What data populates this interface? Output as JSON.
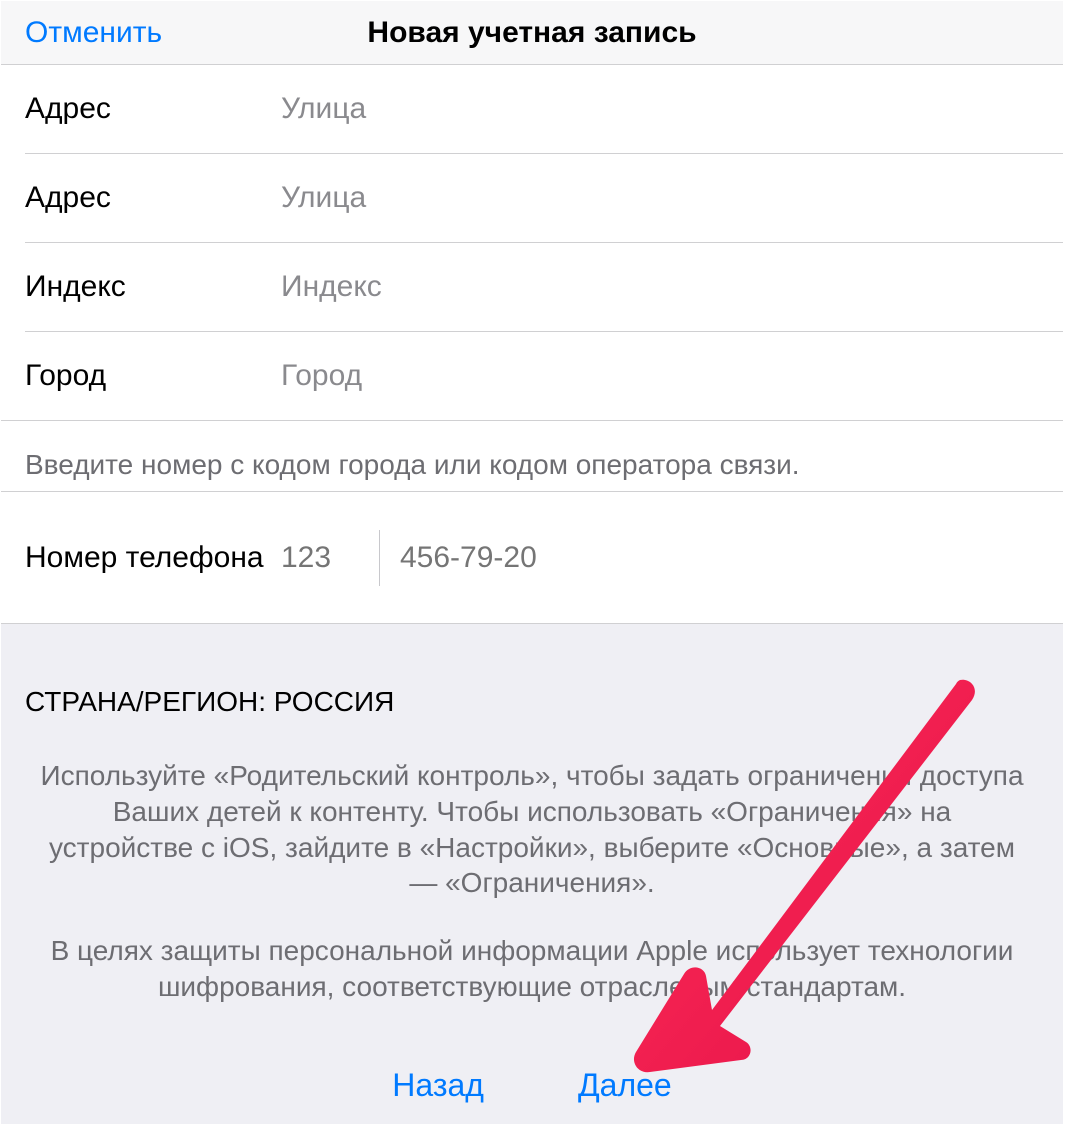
{
  "header": {
    "cancel": "Отменить",
    "title": "Новая учетная запись"
  },
  "fields": {
    "address1_label": "Адрес",
    "address1_placeholder": "Улица",
    "address2_label": "Адрес",
    "address2_placeholder": "Улица",
    "postal_label": "Индекс",
    "postal_placeholder": "Индекс",
    "city_label": "Город",
    "city_placeholder": "Город"
  },
  "phone": {
    "hint": "Введите номер с кодом города или кодом оператора связи.",
    "label": "Номер телефона",
    "area_placeholder": "123",
    "number_placeholder": "456-79-20"
  },
  "footer": {
    "region": "СТРАНА/РЕГИОН: РОССИЯ",
    "text1": "Используйте «Родительский контроль», чтобы задать ограничения доступа Ваших детей к контенту. Чтобы использовать «Ограничения» на устройстве с iOS, зайдите в «Настройки», выберите «Основные», а затем — «Ограничения».",
    "text2": "В целях защиты персональной информации Apple использует технологии шифрования, соответствующие отраслевым стандартам.",
    "back": "Назад",
    "next": "Далее"
  }
}
